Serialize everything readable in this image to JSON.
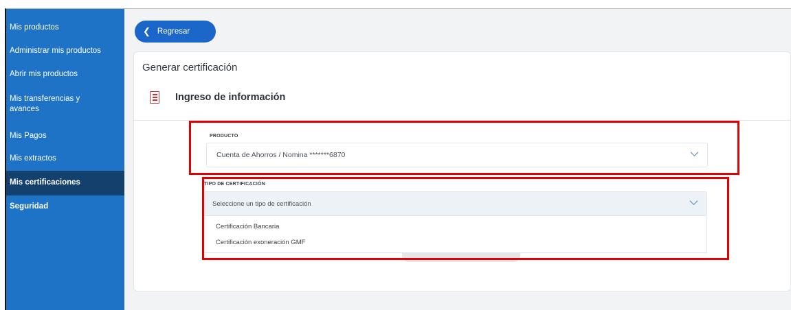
{
  "sidebar": {
    "items": [
      {
        "label": "Mis productos"
      },
      {
        "label": "Administrar mis productos"
      },
      {
        "label": "Abrir mis productos"
      },
      {
        "label": "Mis transferencias y avances"
      },
      {
        "label": "Mis Pagos"
      },
      {
        "label": "Mis extractos"
      },
      {
        "label": "Mis certificaciones",
        "active": true
      },
      {
        "label": "Seguridad"
      }
    ]
  },
  "header": {
    "back_label": "Regresar"
  },
  "main": {
    "title": "Generar certificación",
    "section_title": "Ingreso de información",
    "producto": {
      "label": "PRODUCTO",
      "value": "Cuenta de Ahorros / Nomina *******6870"
    },
    "tipo": {
      "label": "TIPO DE CERTIFICACIÓN",
      "placeholder": "Seleccione un tipo de certificación",
      "options": [
        "Certificación Bancaria",
        "Certificación exoneración GMF"
      ]
    }
  },
  "colors": {
    "sidebar_bg": "#1e73c6",
    "sidebar_active": "#13406c",
    "primary_button": "#1b66c9",
    "highlight": "#e30000"
  },
  "icons": [
    "chevron-left-icon",
    "form-list-icon",
    "chevron-down-icon"
  ]
}
